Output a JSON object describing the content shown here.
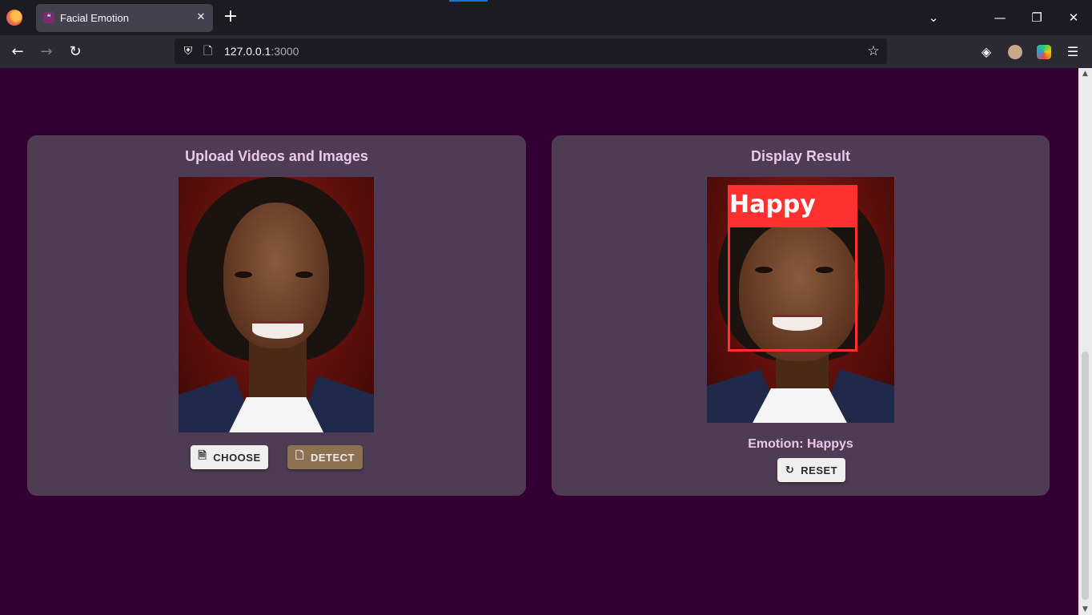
{
  "browser": {
    "tab_title": "Facial Emotion",
    "tab_close": "✕",
    "new_tab": "+",
    "url_host": "127.0.0.1",
    "url_port": ":3000",
    "list_tabs": "⌄",
    "minimize": "—",
    "restore": "❐",
    "close": "✕",
    "back": "←",
    "forward": "→",
    "reload": "↻",
    "menu": "☰",
    "star": "☆",
    "shield": "⛨",
    "page": "🗋",
    "pocket": "◈"
  },
  "upload_panel": {
    "title": "Upload Videos and Images",
    "choose_label": "CHOOSE",
    "detect_label": "DETECT",
    "choose_icon": "🗎",
    "detect_icon": "🗋"
  },
  "result_panel": {
    "title": "Display Result",
    "detection_label": "Happy",
    "emotion_text": "Emotion: Happys",
    "reset_label": "RESET",
    "reset_icon": "↻"
  },
  "colors": {
    "page_bg": "#330033",
    "card_bg": "#4e3c54",
    "title_text": "#ebc7ea",
    "detect_button": "#8c7250",
    "detection_box": "#ff3030"
  }
}
